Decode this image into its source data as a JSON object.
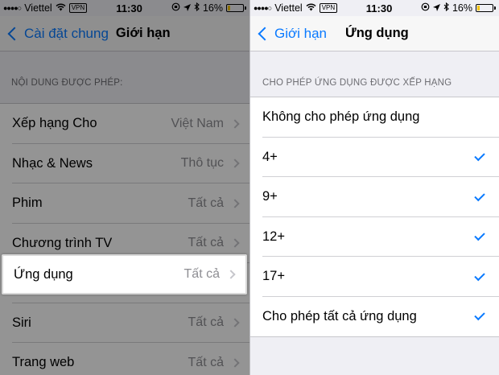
{
  "colors": {
    "accent": "#0a7aff",
    "battery": "#f5c400"
  },
  "left": {
    "status": {
      "signal": "●●●●○",
      "carrier": "Viettel",
      "vpn": "VPN",
      "time": "11:30",
      "battery_pct": "16%"
    },
    "nav": {
      "back_label": "Cài đặt chung",
      "title": "Giới hạn"
    },
    "section_header": "NỘI DUNG ĐƯỢC PHÉP:",
    "items": [
      {
        "label": "Xếp hạng Cho",
        "value": "Việt Nam"
      },
      {
        "label": "Nhạc & News",
        "value": "Thô tục"
      },
      {
        "label": "Phim",
        "value": "Tất cả"
      },
      {
        "label": "Chương trình TV",
        "value": "Tất cả"
      },
      {
        "label": "Ứng dụng",
        "value": "Tất cả"
      },
      {
        "label": "Siri",
        "value": "Tất cả"
      },
      {
        "label": "Trang web",
        "value": "Tất cả"
      }
    ]
  },
  "right": {
    "status": {
      "signal": "●●●●○",
      "carrier": "Viettel",
      "vpn": "VPN",
      "time": "11:30",
      "battery_pct": "16%"
    },
    "nav": {
      "back_label": "Giới hạn",
      "title": "Ứng dụng"
    },
    "section_header": "CHO PHÉP ỨNG DỤNG ĐƯỢC XẾP HẠNG",
    "options": [
      {
        "label": "Không cho phép ứng dụng",
        "checked": false
      },
      {
        "label": "4+",
        "checked": true
      },
      {
        "label": "9+",
        "checked": true
      },
      {
        "label": "12+",
        "checked": true
      },
      {
        "label": "17+",
        "checked": true
      },
      {
        "label": "Cho phép tất cả ứng dụng",
        "checked": true
      }
    ]
  }
}
